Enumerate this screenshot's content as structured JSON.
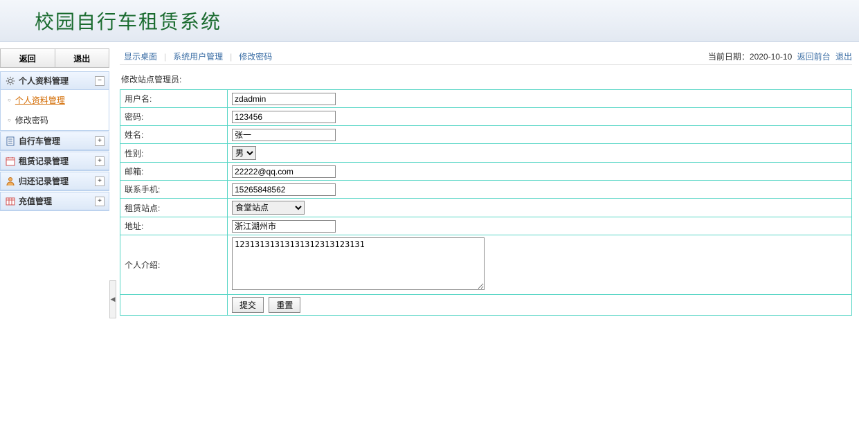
{
  "header": {
    "title": "校园自行车租赁系统"
  },
  "sidebar": {
    "back_label": "返回",
    "logout_label": "退出",
    "panels": [
      {
        "title": "个人资料管理",
        "expanded": true,
        "items": [
          {
            "label": "个人资料管理",
            "active": true
          },
          {
            "label": "修改密码",
            "active": false
          }
        ]
      },
      {
        "title": "自行车管理",
        "expanded": false
      },
      {
        "title": "租赁记录管理",
        "expanded": false
      },
      {
        "title": "归还记录管理",
        "expanded": false
      },
      {
        "title": "充值管理",
        "expanded": false
      }
    ]
  },
  "crumbs": {
    "show_desktop": "显示桌面",
    "system_users": "系统用户管理",
    "change_password": "修改密码",
    "date_label": "当前日期：",
    "date_value": "2020-10-10",
    "back_front": "返回前台",
    "exit": "退出"
  },
  "form": {
    "title": "修改站点管理员:",
    "rows": {
      "username_label": "用户名:",
      "username_value": "zdadmin",
      "password_label": "密码:",
      "password_value": "123456",
      "name_label": "姓名:",
      "name_value": "张一",
      "gender_label": "性别:",
      "gender_value": "男",
      "email_label": "邮箱:",
      "email_value": "22222@qq.com",
      "phone_label": "联系手机:",
      "phone_value": "15265848562",
      "station_label": "租赁站点:",
      "station_value": "食堂站点",
      "address_label": "地址:",
      "address_value": "浙江湖州市",
      "bio_label": "个人介绍:",
      "bio_value": "12313131313131312313123131"
    },
    "submit_label": "提交",
    "reset_label": "重置"
  }
}
